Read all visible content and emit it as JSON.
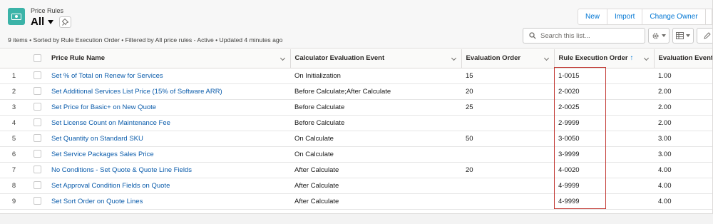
{
  "header": {
    "object_label": "Price Rules",
    "view_name": "All",
    "meta": "9 items • Sorted by Rule Execution Order • Filtered by All price rules - Active • Updated 4 minutes ago"
  },
  "actions": {
    "new": "New",
    "import": "Import",
    "change_owner": "Change Owner"
  },
  "search": {
    "placeholder": "Search this list..."
  },
  "columns": {
    "name": "Price Rule Name",
    "calc_event": "Calculator Evaluation Event",
    "eval_order": "Evaluation Order",
    "rule_exec_order": "Rule Execution Order",
    "eval_event": "Evaluation Event"
  },
  "sort_indicator": "↑",
  "rows": [
    {
      "num": "1",
      "name": "Set % of Total on Renew for Services",
      "calc_event": "On Initialization",
      "eval_order": "15",
      "rule_exec_order": "1-0015",
      "eval_event": "1.00"
    },
    {
      "num": "2",
      "name": "Set Additional Services List Price (15% of Software ARR)",
      "calc_event": "Before Calculate;After Calculate",
      "eval_order": "20",
      "rule_exec_order": "2-0020",
      "eval_event": "2.00"
    },
    {
      "num": "3",
      "name": "Set Price for Basic+ on New Quote",
      "calc_event": "Before Calculate",
      "eval_order": "25",
      "rule_exec_order": "2-0025",
      "eval_event": "2.00"
    },
    {
      "num": "4",
      "name": "Set License Count on Maintenance Fee",
      "calc_event": "Before Calculate",
      "eval_order": "",
      "rule_exec_order": "2-9999",
      "eval_event": "2.00"
    },
    {
      "num": "5",
      "name": "Set Quantity on Standard SKU",
      "calc_event": "On Calculate",
      "eval_order": "50",
      "rule_exec_order": "3-0050",
      "eval_event": "3.00"
    },
    {
      "num": "6",
      "name": "Set Service Packages Sales Price",
      "calc_event": "On Calculate",
      "eval_order": "",
      "rule_exec_order": "3-9999",
      "eval_event": "3.00"
    },
    {
      "num": "7",
      "name": "No Conditions - Set Quote & Quote Line Fields",
      "calc_event": "After Calculate",
      "eval_order": "20",
      "rule_exec_order": "4-0020",
      "eval_event": "4.00"
    },
    {
      "num": "8",
      "name": "Set Approval Condition Fields on Quote",
      "calc_event": "After Calculate",
      "eval_order": "",
      "rule_exec_order": "4-9999",
      "eval_event": "4.00"
    },
    {
      "num": "9",
      "name": "Set Sort Order on Quote Lines",
      "calc_event": "After Calculate",
      "eval_order": "",
      "rule_exec_order": "4-9999",
      "eval_event": "4.00"
    }
  ],
  "colors": {
    "accent": "#0176d3",
    "link": "#0b5cab",
    "object_icon": "#3bb3a8",
    "highlight_box": "#c23934"
  },
  "icons": {
    "object": "price-rules-icon",
    "pin": "pin-icon",
    "search": "search-icon",
    "settings": "gear-icon",
    "display": "table-icon"
  }
}
